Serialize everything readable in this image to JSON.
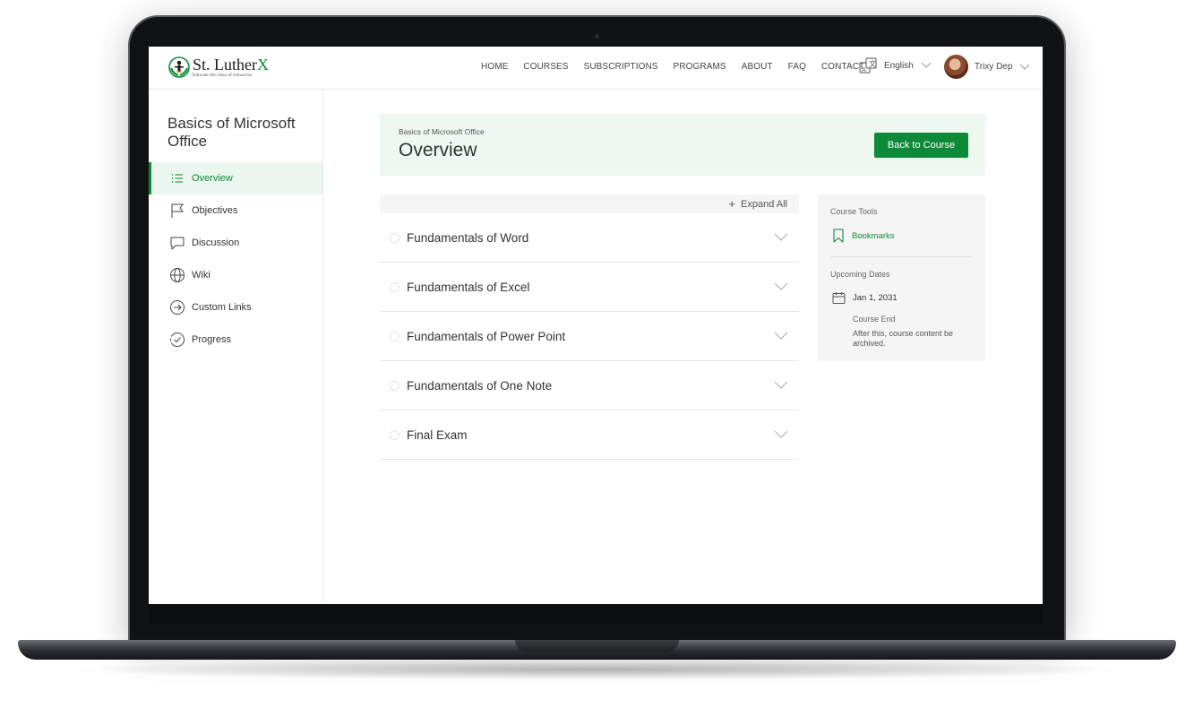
{
  "header": {
    "logo_name": "St. Luther",
    "logo_x": "X",
    "logo_tagline": "Educate the class of tomorrow",
    "nav": [
      "HOME",
      "COURSES",
      "SUBSCRIPTIONS",
      "PROGRAMS",
      "ABOUT",
      "FAQ",
      "CONTACT"
    ],
    "language": "English",
    "user_name": "Trixy Dep"
  },
  "sidebar": {
    "course_title": "Basics of Microsoft Office",
    "items": [
      {
        "label": "Overview",
        "icon": "list-icon",
        "active": true
      },
      {
        "label": "Objectives",
        "icon": "flag-icon",
        "active": false
      },
      {
        "label": "Discussion",
        "icon": "chat-bubble-icon",
        "active": false
      },
      {
        "label": "Wiki",
        "icon": "globe-icon",
        "active": false
      },
      {
        "label": "Custom Links",
        "icon": "arrow-circle-icon",
        "active": false
      },
      {
        "label": "Progress",
        "icon": "check-circle-icon",
        "active": false
      }
    ]
  },
  "main": {
    "breadcrumb": "Basics of Microsoft Office",
    "title": "Overview",
    "back_button": "Back to Course",
    "expand_all": "Expand All",
    "sections": [
      {
        "title": "Fundamentals of Word"
      },
      {
        "title": "Fundamentals of Excel"
      },
      {
        "title": "Fundamentals of Power Point"
      },
      {
        "title": "Fundamentals of One Note"
      },
      {
        "title": "Final Exam"
      }
    ]
  },
  "tools": {
    "heading": "Course Tools",
    "bookmarks": "Bookmarks",
    "upcoming_heading": "Upcoming Dates",
    "date": "Jan 1, 2031",
    "date_label": "Course End",
    "date_desc": "After this, course content be archived."
  },
  "colors": {
    "accent": "#0d8a37",
    "hero_bg": "#eef8f1",
    "panel_bg": "#f5f5f5"
  }
}
